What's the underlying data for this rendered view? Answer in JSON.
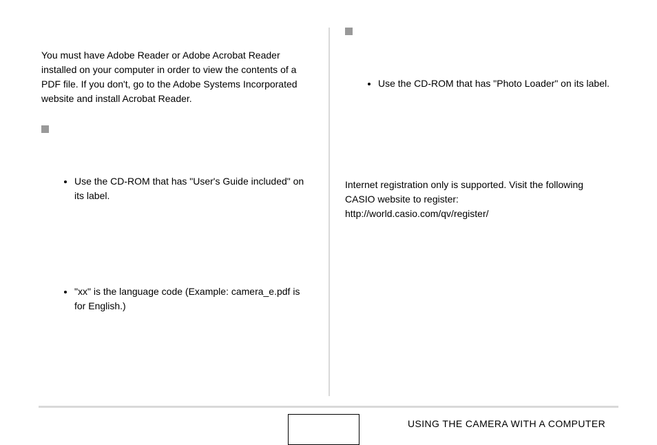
{
  "left": {
    "intro": "You must have Adobe Reader or Adobe Acrobat Reader installed on your computer in order to view the contents of a PDF file. If you don't, go to the Adobe Systems Incorporated website and install Acrobat Reader.",
    "bullet1": "Use the CD-ROM that has \"User's Guide included\" on its label.",
    "bullet2": "\"xx\" is the language code (Example: camera_e.pdf is for English.)"
  },
  "right": {
    "bullet1": "Use the CD-ROM that has \"Photo Loader\" on its label.",
    "reg1": "Internet registration only is supported. Visit the following CASIO website to register:",
    "reg2": "http://world.casio.com/qv/register/"
  },
  "footer": "USING THE CAMERA WITH A COMPUTER"
}
